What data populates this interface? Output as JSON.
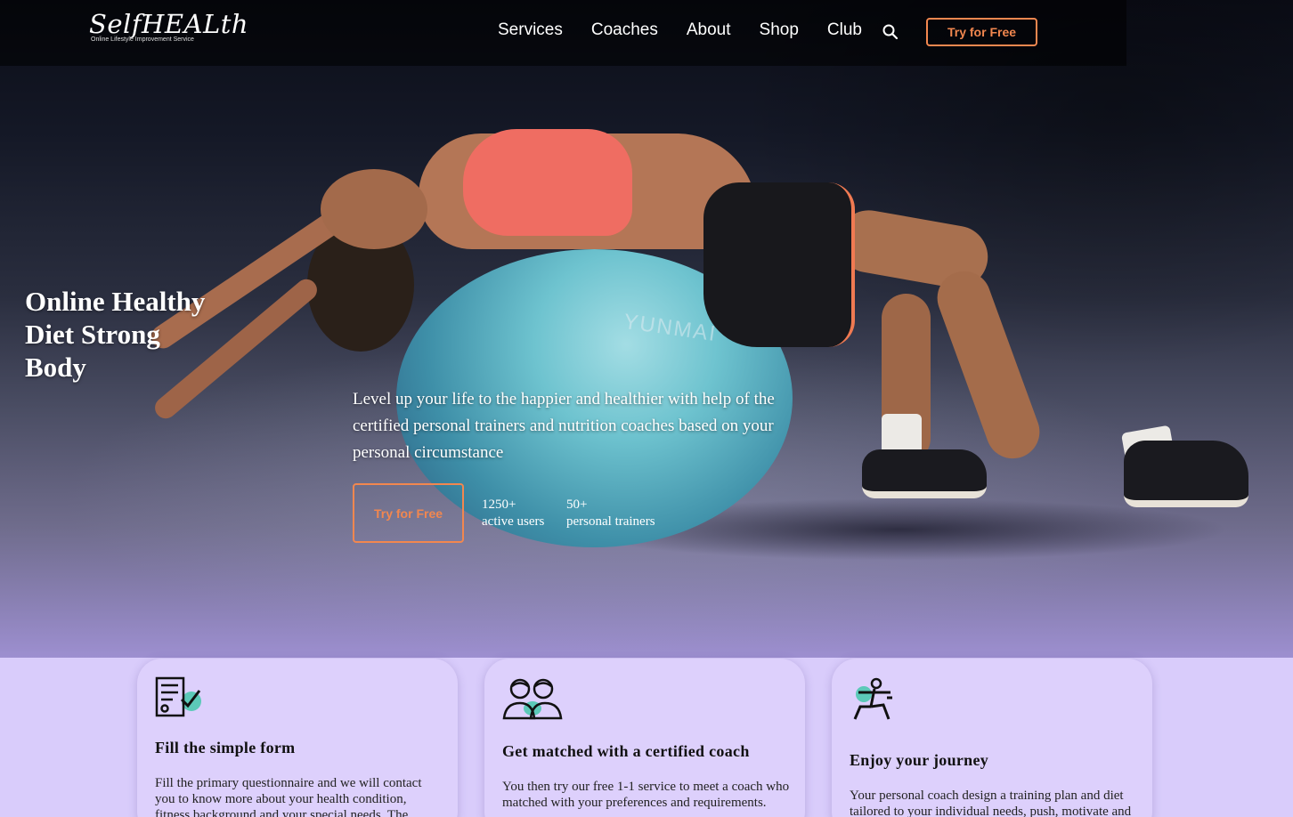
{
  "brand": {
    "name": "SelfHEALth",
    "tagline": "Online Lifestyle Improvement Service"
  },
  "nav": {
    "items": [
      {
        "label": "Services"
      },
      {
        "label": "Coaches"
      },
      {
        "label": "About"
      },
      {
        "label": "Shop"
      },
      {
        "label": "Club"
      }
    ],
    "search_icon": "search-icon",
    "cta_label": "Try for Free"
  },
  "hero": {
    "title_lines": [
      "Online Healthy",
      "Diet Strong",
      "Body"
    ],
    "description": "Level up your life to the happier and healthier with help of the certified personal trainers and nutrition coaches based on your personal circumstance",
    "cta_label": "Try for Free",
    "image_text": "YUNMAI",
    "stats": [
      {
        "value": "1250+",
        "label": "active users"
      },
      {
        "value": "50+",
        "label": "personal trainers"
      }
    ]
  },
  "steps": [
    {
      "icon": "form-check-icon",
      "title": "Fill the simple form",
      "text": "Fill the primary questionnaire and we will contact you to know more about your health condition, fitness background and your special needs. The"
    },
    {
      "icon": "coach-match-icon",
      "title": "Get matched with a certified coach",
      "text": "You then try our free 1-1 service to meet a coach who matched with your preferences and requirements."
    },
    {
      "icon": "exercise-icon",
      "title": "Enjoy your journey",
      "text": "Your personal coach design a training plan and diet tailored to your individual needs, push, motivate and support you to make your life"
    }
  ],
  "colors": {
    "accent": "#f2874f",
    "section_bg": "#d9ccfb",
    "card_bg": "#ddd0fc",
    "icon_teal": "#5cc9b8"
  }
}
